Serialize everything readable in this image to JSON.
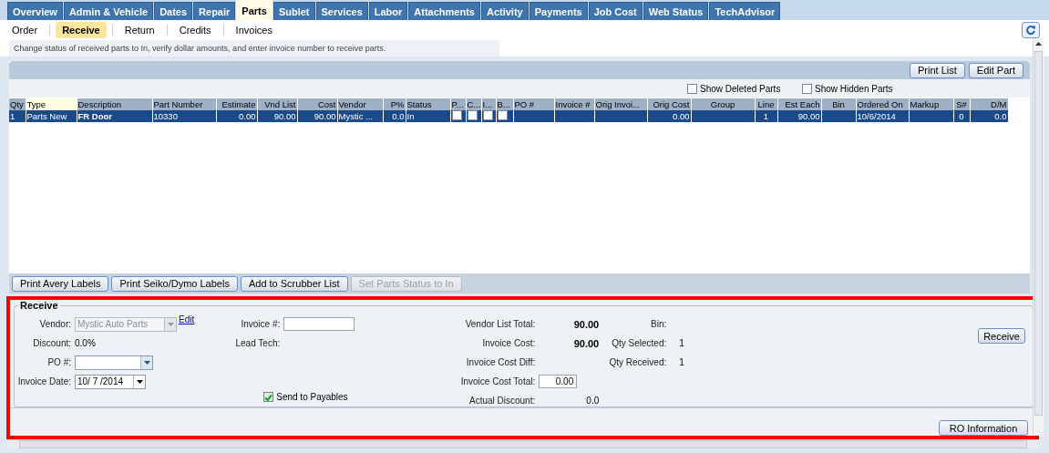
{
  "main_tabs": [
    {
      "label": "Overview",
      "selected": false
    },
    {
      "label": "Admin & Vehicle",
      "selected": false
    },
    {
      "label": "Dates",
      "selected": false
    },
    {
      "label": "Repair",
      "selected": false
    },
    {
      "label": "Parts",
      "selected": true
    },
    {
      "label": "Sublet",
      "selected": false
    },
    {
      "label": "Services",
      "selected": false
    },
    {
      "label": "Labor",
      "selected": false
    },
    {
      "label": "Attachments",
      "selected": false
    },
    {
      "label": "Activity",
      "selected": false
    },
    {
      "label": "Payments",
      "selected": false
    },
    {
      "label": "Job Cost",
      "selected": false
    },
    {
      "label": "Web Status",
      "selected": false
    },
    {
      "label": "TechAdvisor",
      "selected": false
    }
  ],
  "sub_tabs": [
    {
      "label": "Order",
      "selected": false
    },
    {
      "label": "Receive",
      "selected": true
    },
    {
      "label": "Return",
      "selected": false
    },
    {
      "label": "Credits",
      "selected": false
    },
    {
      "label": "Invoices",
      "selected": false
    }
  ],
  "hint": "Change status of received parts to In, verify dollar amounts, and enter invoice number to receive parts.",
  "grid": {
    "toolbar_buttons": [
      "Print List",
      "Edit Part"
    ],
    "options": [
      {
        "label": "Show Deleted Parts",
        "checked": false
      },
      {
        "label": "Show Hidden Parts",
        "checked": false
      }
    ],
    "columns": [
      {
        "label": "Qty",
        "sorted": false
      },
      {
        "label": "Type",
        "sorted": true
      },
      {
        "label": "Description",
        "sorted": false
      },
      {
        "label": "Part Number",
        "sorted": false
      },
      {
        "label": "Estimate",
        "sorted": false
      },
      {
        "label": "Vnd List",
        "sorted": false
      },
      {
        "label": "Cost",
        "sorted": false
      },
      {
        "label": "Vendor",
        "sorted": false
      },
      {
        "label": "P%",
        "sorted": false
      },
      {
        "label": "Status",
        "sorted": false
      },
      {
        "label": "P...",
        "sorted": false
      },
      {
        "label": "C...",
        "sorted": false
      },
      {
        "label": "I...",
        "sorted": false
      },
      {
        "label": "B...",
        "sorted": false
      },
      {
        "label": "PO #",
        "sorted": false
      },
      {
        "label": "Invoice #",
        "sorted": false
      },
      {
        "label": "Orig Invoi...",
        "sorted": false
      },
      {
        "label": "Orig Cost",
        "sorted": false
      },
      {
        "label": "Group",
        "sorted": false
      },
      {
        "label": "Line",
        "sorted": false
      },
      {
        "label": "Est Each",
        "sorted": false
      },
      {
        "label": "Bin",
        "sorted": false
      },
      {
        "label": "Ordered On",
        "sorted": false
      },
      {
        "label": "Markup",
        "sorted": false
      },
      {
        "label": "S#",
        "sorted": false
      },
      {
        "label": "D/M",
        "sorted": false
      }
    ],
    "rows": [
      {
        "selected": true,
        "cells": [
          {
            "kind": "text",
            "text": "1"
          },
          {
            "kind": "text",
            "text": "Parts New"
          },
          {
            "kind": "text",
            "text": "FR Door"
          },
          {
            "kind": "text",
            "text": "10330"
          },
          {
            "kind": "text",
            "text": "0.00"
          },
          {
            "kind": "text",
            "text": "90.00"
          },
          {
            "kind": "text",
            "text": "90.00"
          },
          {
            "kind": "text",
            "text": "Mystic ..."
          },
          {
            "kind": "text",
            "text": "0.0"
          },
          {
            "kind": "text",
            "text": "In"
          },
          {
            "kind": "check",
            "checked": false
          },
          {
            "kind": "check",
            "checked": false
          },
          {
            "kind": "check",
            "checked": false
          },
          {
            "kind": "check",
            "checked": false
          },
          {
            "kind": "text"
          },
          {
            "kind": "text"
          },
          {
            "kind": "text"
          },
          {
            "kind": "text",
            "text": "0.00"
          },
          {
            "kind": "text"
          },
          {
            "kind": "text",
            "text": "1"
          },
          {
            "kind": "text",
            "text": "90.00"
          },
          {
            "kind": "text"
          },
          {
            "kind": "text",
            "text": "10/6/2014"
          },
          {
            "kind": "text"
          },
          {
            "kind": "text",
            "text": "0"
          },
          {
            "kind": "text",
            "text": "0.0"
          }
        ]
      }
    ],
    "action_buttons": [
      {
        "label": "Print Avery Labels",
        "disabled": false
      },
      {
        "label": "Print Seiko/Dymo Labels",
        "disabled": false
      },
      {
        "label": "Add to Scrubber List",
        "disabled": false
      },
      {
        "label": "Set Parts Status to In",
        "disabled": true
      }
    ]
  },
  "receive": {
    "title": "Receive",
    "columns": [
      [
        {
          "kind": "dropdown",
          "label": "Vendor:",
          "value": "Mystic Auto Parts",
          "disabled": true,
          "link": "Edit"
        },
        {
          "kind": "text",
          "label": "Discount:",
          "value": "0.0%"
        },
        {
          "kind": "combo",
          "label": "PO #:"
        },
        {
          "kind": "date",
          "label": "Invoice Date:",
          "value": "10/ 7 /2014"
        }
      ],
      [
        {
          "kind": "input",
          "label": "Invoice #:"
        },
        {
          "kind": "text",
          "label": "Lead Tech:"
        },
        {
          "kind": "check",
          "label": "Send to Payables",
          "checked": true
        }
      ],
      [
        {
          "kind": "text",
          "label": "Vendor List Total:",
          "value": "90.00",
          "bold": true
        },
        {
          "kind": "text",
          "label": "Invoice Cost:",
          "value": "90.00",
          "bold": true
        },
        {
          "kind": "text",
          "label": "Invoice Cost Diff:"
        },
        {
          "kind": "input",
          "label": "Invoice Cost Total:",
          "value": "0.00"
        },
        {
          "kind": "text",
          "label": "Actual Discount:",
          "value": "0.0"
        }
      ],
      [
        {
          "kind": "text",
          "label": "Bin:"
        },
        {
          "kind": "text",
          "label": "Qty Selected:",
          "value": "1"
        },
        {
          "kind": "text",
          "label": "Qty Received:",
          "value": "1"
        }
      ]
    ],
    "button": "Receive"
  },
  "footer_button": "RO Information"
}
